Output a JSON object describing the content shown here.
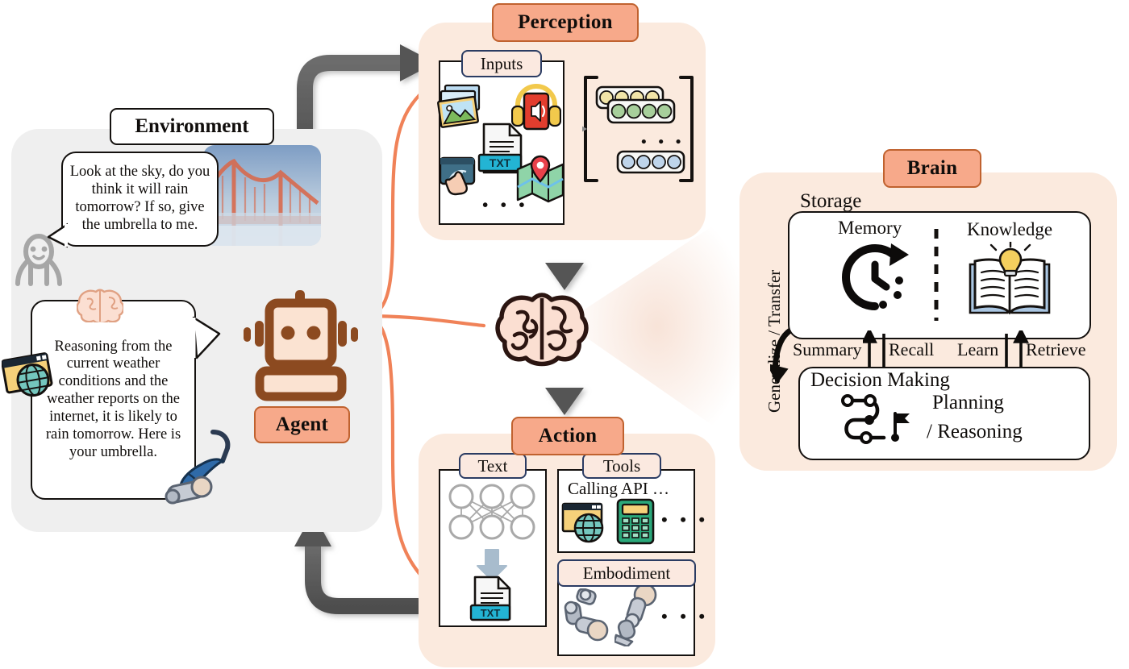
{
  "figure": {
    "type": "diagram",
    "description": "Conceptual architecture of an LLM-based agent: Environment, Perception, Brain, Action"
  },
  "colors": {
    "badge_fill": "#f7a98a",
    "badge_border": "#c0622f",
    "panel_peach": "#fbeade",
    "panel_gray": "#efefef",
    "sub_badge_fill": "#fbe9e0",
    "sub_badge_border": "#2b3c63",
    "connector_orange": "#f08258",
    "arrow_gray": "#585858",
    "robot_brown": "#8c4a20",
    "robot_fill": "#fbe3d2",
    "brain_fill": "#fbdfd2",
    "brain_stroke": "#2b1511"
  },
  "environment": {
    "title": "Environment",
    "agent_label": "Agent",
    "user_bubble": "Look at the sky, do you think it will rain tomorrow? If so, give the umbrella to me.",
    "agent_bubble": "Reasoning from the current weather conditions and the weather reports on the internet, it is likely to rain tomorrow. Here is your umbrella.",
    "icons": {
      "user": "person-icon",
      "scene": "golden-gate-bridge-photo",
      "thought": "brain-icon",
      "browser": "web-browser-icon",
      "robot_arm": "robot-arm-with-umbrella-icon"
    }
  },
  "perception": {
    "title": "Perception",
    "inputs_label": "Inputs",
    "input_icons": [
      {
        "name": "images-icon",
        "label": "Images"
      },
      {
        "name": "audio-headphones-icon",
        "label": "Audio"
      },
      {
        "name": "text-file-icon",
        "label": "TXT"
      },
      {
        "name": "touch-sensor-icon",
        "label": "Touch"
      },
      {
        "name": "map-location-icon",
        "label": "Map"
      }
    ],
    "more_dots": "• • •",
    "embedding_dots": "• • •",
    "embeddings": [
      {
        "name": "yellow-embedding-row",
        "color": "#f2e5a8",
        "count": 4
      },
      {
        "name": "green-embedding-row",
        "color": "#a7cf9b",
        "count": 4
      },
      {
        "name": "blue-embedding-row",
        "color": "#bed4ea",
        "count": 4
      }
    ]
  },
  "brain": {
    "title": "Brain",
    "generalize_transfer": "Generalize / Transfer",
    "storage": {
      "title": "Storage",
      "memory_label": "Memory",
      "knowledge_label": "Knowledge",
      "memory_icon": "clock-history-icon",
      "knowledge_icon": "open-book-lightbulb-icon"
    },
    "flows": [
      {
        "name": "summary",
        "label": "Summary",
        "direction": "up"
      },
      {
        "name": "recall",
        "label": "Recall",
        "direction": "down"
      },
      {
        "name": "learn",
        "label": "Learn",
        "direction": "down"
      },
      {
        "name": "retrieve",
        "label": "Retrieve",
        "direction": "up"
      }
    ],
    "decision": {
      "title": "Decision Making",
      "planning": "Planning",
      "reasoning": "/ Reasoning",
      "icon": "path-planning-flag-icon"
    }
  },
  "action": {
    "title": "Action",
    "text": {
      "label": "Text",
      "network_icon": "neural-network-icon",
      "arrow_icon": "down-arrow-icon",
      "output_icon": "text-file-icon",
      "output_label": "TXT"
    },
    "tools": {
      "label": "Tools",
      "caption": "Calling API …",
      "icons": [
        {
          "name": "web-browser-icon"
        },
        {
          "name": "calculator-icon"
        }
      ],
      "more_dots": "• • •"
    },
    "embodiment": {
      "label": "Embodiment",
      "icons": [
        {
          "name": "robot-arm-icon"
        },
        {
          "name": "robot-leg-icon"
        }
      ],
      "more_dots": "• • •"
    }
  },
  "central": {
    "brain_icon": "central-brain-icon",
    "arrow_in": "down-arrow-perception-to-brain",
    "arrow_out": "down-arrow-brain-to-action"
  },
  "loop_arrows": {
    "env_to_perception": "environment-to-perception-arrow",
    "action_to_env": "action-to-environment-arrow"
  }
}
